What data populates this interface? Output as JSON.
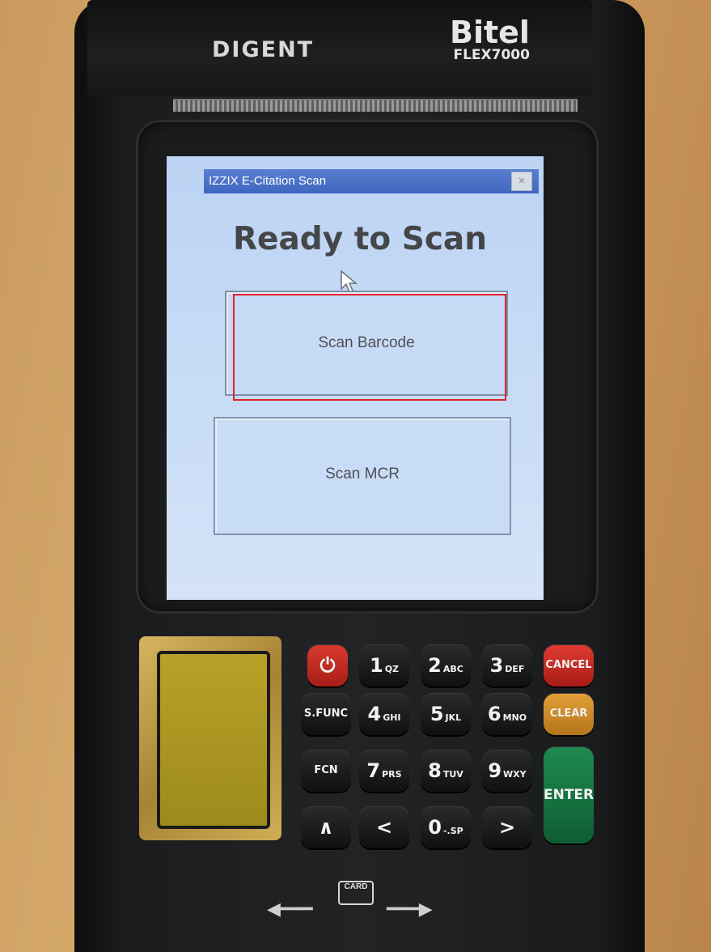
{
  "device": {
    "brand_left": "DIGENT",
    "brand_right": "Bitel",
    "model": "FLEX7000"
  },
  "window": {
    "title": "IZZIX E-Citation Scan",
    "close_glyph": "×"
  },
  "screen": {
    "heading": "Ready to Scan",
    "buttons": {
      "scan_barcode": "Scan Barcode",
      "scan_mcr": "Scan MCR"
    }
  },
  "keypad": {
    "power": "⏻",
    "k1": {
      "main": "1",
      "sub": "QZ"
    },
    "k2": {
      "main": "2",
      "sub": "ABC"
    },
    "k3": {
      "main": "3",
      "sub": "DEF"
    },
    "cancel": "CANCEL",
    "sfunc": "S.FUNC",
    "k4": {
      "main": "4",
      "sub": "GHI"
    },
    "k5": {
      "main": "5",
      "sub": "JKL"
    },
    "k6": {
      "main": "6",
      "sub": "MNO"
    },
    "clear": "CLEAR",
    "fcn": "FCN",
    "k7": {
      "main": "7",
      "sub": "PRS"
    },
    "k8": {
      "main": "8",
      "sub": "TUV"
    },
    "k9": {
      "main": "9",
      "sub": "WXY"
    },
    "enter": "ENTER",
    "up": "∧",
    "left": "<",
    "k0": {
      "main": "0",
      "sub": "-.SP"
    },
    "right": ">"
  },
  "card_slot": {
    "label": "CARD"
  },
  "colors": {
    "highlight": "#e0202a",
    "titlebar": "#3f66bf",
    "screen_bg": "#c5daf6"
  }
}
